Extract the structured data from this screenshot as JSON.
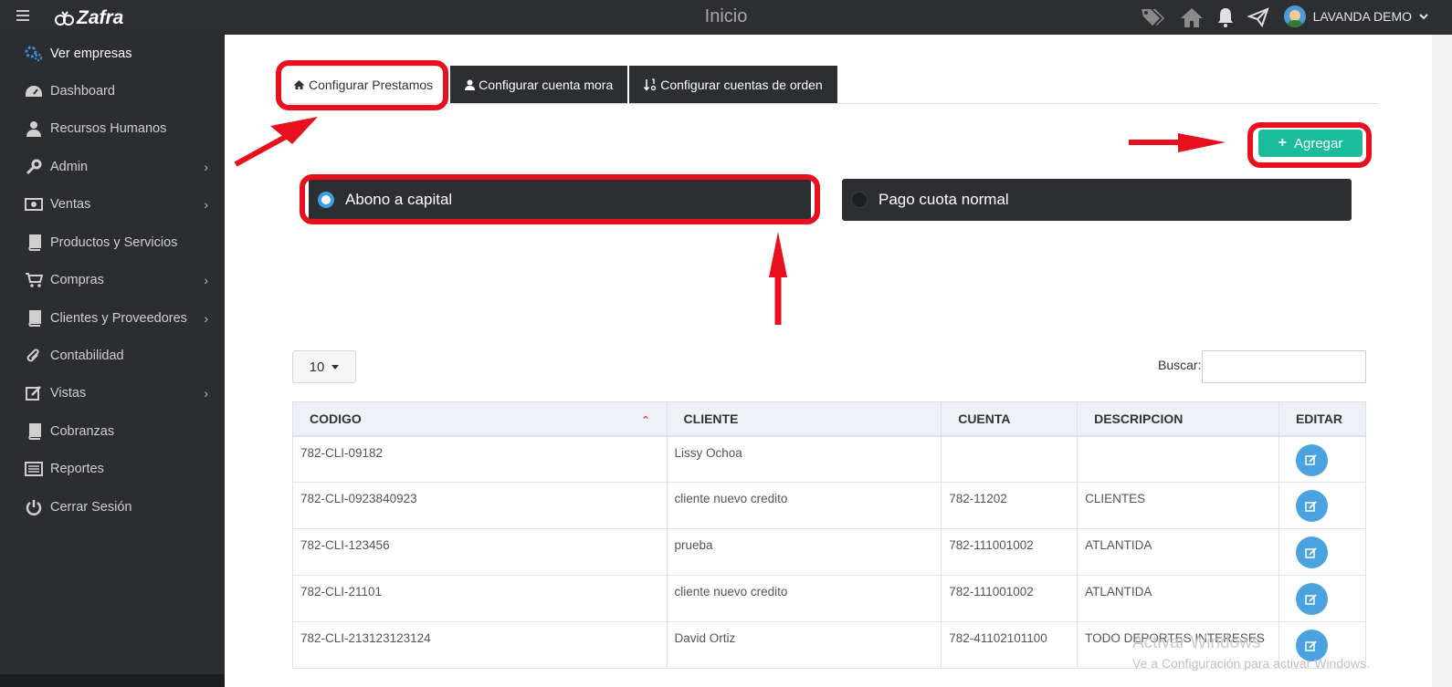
{
  "header": {
    "brand": "Zafra",
    "title": "Inicio",
    "user_name": "LAVANDA DEMO"
  },
  "sidebar": {
    "items": [
      {
        "label": "Ver empresas",
        "icon": "gears-icon"
      },
      {
        "label": "Dashboard",
        "icon": "dashboard-icon"
      },
      {
        "label": "Recursos Humanos",
        "icon": "user-icon"
      },
      {
        "label": "Admin",
        "icon": "wrench-icon"
      },
      {
        "label": "Ventas",
        "icon": "money-icon"
      },
      {
        "label": "Productos y Servicios",
        "icon": "book-icon"
      },
      {
        "label": "Compras",
        "icon": "cart-icon"
      },
      {
        "label": "Clientes y Proveedores",
        "icon": "book-icon"
      },
      {
        "label": "Contabilidad",
        "icon": "paperclip-icon"
      },
      {
        "label": "Vistas",
        "icon": "edit-icon"
      },
      {
        "label": "Cobranzas",
        "icon": "book-icon"
      },
      {
        "label": "Reportes",
        "icon": "list-icon"
      },
      {
        "label": "Cerrar Sesión",
        "icon": "power-icon"
      }
    ]
  },
  "tabs": [
    {
      "label": "Configurar Prestamos"
    },
    {
      "label": "Configurar cuenta mora"
    },
    {
      "label": "Configurar cuentas de orden"
    }
  ],
  "actions": {
    "add_label": "Agregar"
  },
  "options": {
    "abono": "Abono a capital",
    "pago": "Pago cuota normal"
  },
  "table_controls": {
    "page_size": "10",
    "search_label": "Buscar:",
    "search_value": ""
  },
  "table": {
    "headers": [
      "CODIGO",
      "CLIENTE",
      "CUENTA",
      "DESCRIPCION",
      "EDITAR"
    ],
    "rows": [
      [
        "782-CLI-09182",
        "Lissy Ochoa",
        "",
        ""
      ],
      [
        "782-CLI-0923840923",
        "cliente nuevo credito",
        "782-11202",
        "CLIENTES"
      ],
      [
        "782-CLI-123456",
        "prueba",
        "782-111001002",
        "ATLANTIDA"
      ],
      [
        "782-CLI-21101",
        "cliente nuevo credito",
        "782-111001002",
        "ATLANTIDA"
      ],
      [
        "782-CLI-213123123124",
        "David Ortiz",
        "782-41102101100",
        "TODO DEPORTES INTERESES"
      ]
    ]
  },
  "watermark": {
    "line1": "Activar Windows",
    "line2": "Ve a Configuración para activar Windows."
  },
  "colors": {
    "accent": "#1abc9c",
    "dark": "#2c2e31",
    "annotation": "#e8101e",
    "edit_button": "#4aa3df"
  }
}
